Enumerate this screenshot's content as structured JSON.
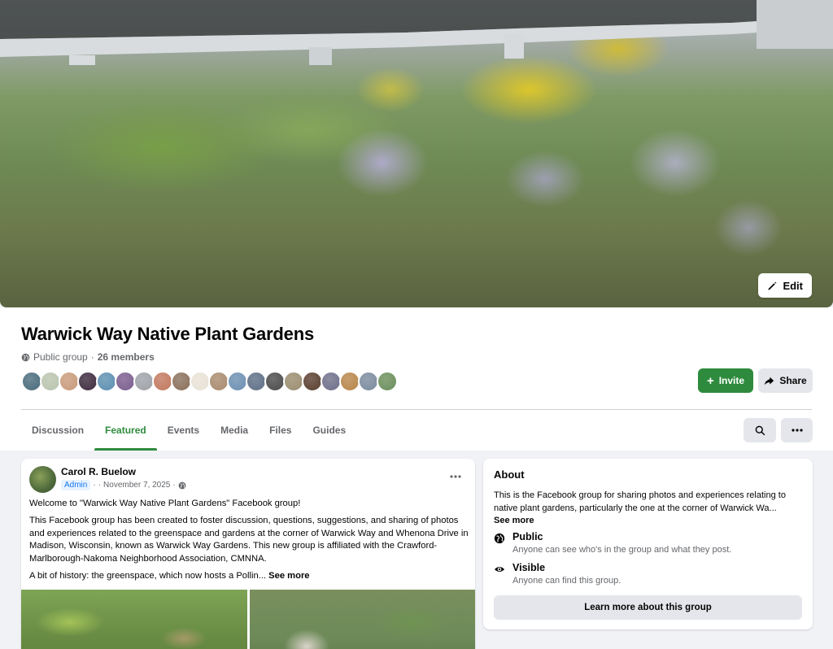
{
  "cover": {
    "edit_label": "Edit"
  },
  "group": {
    "name": "Warwick Way Native Plant Gardens",
    "privacy": "Public group",
    "separator": "·",
    "member_count": "26 members",
    "member_avatar_colors": [
      "#4a6b7c",
      "#b9c4ae",
      "#c89a7a",
      "#3d2b3e",
      "#5c8fb0",
      "#7a5c8e",
      "#9ea2a8",
      "#c2785e",
      "#8a6f5a",
      "#e8e2d6",
      "#a88a6e",
      "#6c8fb2",
      "#5e6e86",
      "#4a4a4a",
      "#9a8c6e",
      "#5a3e2e",
      "#6e6e8a",
      "#b8864a",
      "#7a8a9e",
      "#6a8e5a"
    ]
  },
  "actions": {
    "invite_label": "Invite",
    "share_label": "Share"
  },
  "tabs": [
    {
      "label": "Discussion"
    },
    {
      "label": "Featured"
    },
    {
      "label": "Events"
    },
    {
      "label": "Media"
    },
    {
      "label": "Files"
    },
    {
      "label": "Guides"
    }
  ],
  "post": {
    "author": "Carol R. Buelow",
    "role": "Admin",
    "date": "November 7, 2025",
    "sep": "·",
    "paragraphs": [
      "Welcome to \"Warwick Way Native Plant Gardens\" Facebook group!",
      "This Facebook group has been created to foster discussion, questions, suggestions, and sharing of photos and experiences related to the greenspace and gardens at the corner of Warwick Way and Whenona Drive in Madison, Wisconsin, known as Warwick Way Gardens. This new group is affiliated with the Crawford-Marlborough-Nakoma Neighborhood Association, CMNNA."
    ],
    "history_preview": "A bit of history: the greenspace, which now hosts a Pollin...",
    "see_more": "See more"
  },
  "about": {
    "title": "About",
    "description": "This is the Facebook group for sharing photos and experiences relating to native plant gardens, particularly the one at the corner of Warwick Wa...",
    "see_more": "See more",
    "public_title": "Public",
    "public_desc": "Anyone can see who's in the group and what they post.",
    "visible_title": "Visible",
    "visible_desc": "Anyone can find this group.",
    "learn_more": "Learn more about this group"
  },
  "colors": {
    "accent_green": "#2e8b3e",
    "admin_blue": "#1877f2",
    "secondary_gray": "#e4e6eb",
    "muted_text": "#65676b"
  }
}
